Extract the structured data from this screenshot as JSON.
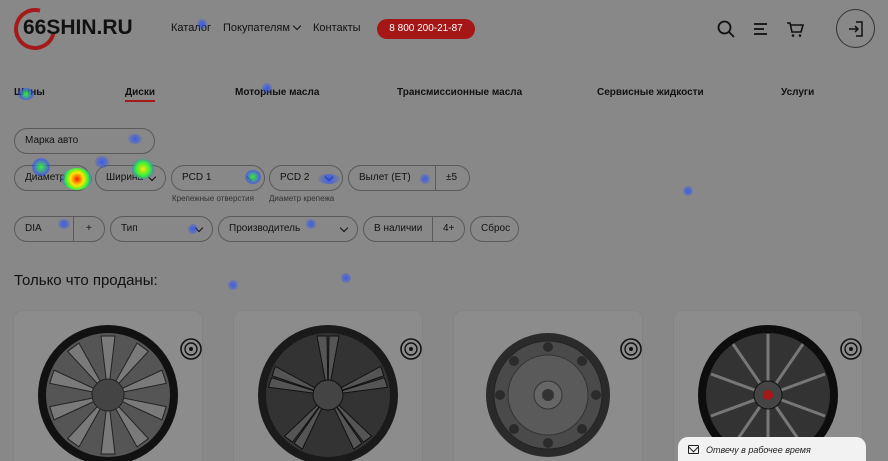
{
  "header": {
    "logo_text": "66SHIN.RU",
    "nav": {
      "catalog": "Каталог",
      "buyers": "Покупателям",
      "contacts": "Контакты"
    },
    "phone": "8 800 200-21-87",
    "icons": [
      "search-icon",
      "menu-icon",
      "cart-icon",
      "login-icon"
    ]
  },
  "categories": [
    {
      "label": "Шины"
    },
    {
      "label": "Диски",
      "active": true
    },
    {
      "label": "Моторные масла"
    },
    {
      "label": "Трансмиссионные масла"
    },
    {
      "label": "Сервисные жидкости"
    },
    {
      "label": "Услуги"
    }
  ],
  "filters": {
    "car_brand": "Марка авто",
    "diameter": "Диаметр",
    "width": "Ширина",
    "pcd1": "PCD 1",
    "pcd1_hint": "Крепежные отверстия",
    "pcd2": "PCD 2",
    "pcd2_hint": "Диаметр крепежа",
    "offset": "Вылет (ET)",
    "offset_tol": "±5",
    "dia": "DIA",
    "dia_plus": "+",
    "type": "Тип",
    "manufacturer": "Производитель",
    "in_stock": "В наличии",
    "in_stock_min": "4+",
    "reset": "Сброс"
  },
  "section_title": "Только что проданы:",
  "products": [
    {
      "kind": "alloy-10-spoke",
      "badge": "tire-icon"
    },
    {
      "kind": "alloy-5-double-spoke",
      "badge": "tire-icon"
    },
    {
      "kind": "steel",
      "badge": "tire-icon"
    },
    {
      "kind": "alloy-multi-spoke",
      "badge": "tire-icon"
    }
  ],
  "chat": {
    "text": "Отвечу в рабочее время"
  },
  "colors": {
    "accent": "#a51616",
    "overlay": "#888888"
  }
}
